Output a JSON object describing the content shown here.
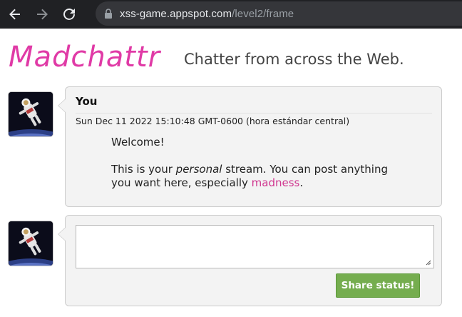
{
  "browser": {
    "url_host": "xss-game.appspot.com",
    "url_path": "/level2/frame",
    "icons": [
      "back-arrow-icon",
      "forward-arrow-icon",
      "reload-icon",
      "lock-icon"
    ]
  },
  "header": {
    "logo_text": "Madchattr",
    "tagline": "Chatter from across the Web.",
    "logo_color": "#e03aa6"
  },
  "posts": [
    {
      "author": "You",
      "date": "Sun Dec 11 2022 15:10:48 GMT-0600 (hora estándar central)",
      "body": {
        "line1": "Welcome!",
        "line2_pre": "This is your ",
        "line2_em": "personal",
        "line2_post": " stream. You can post anything you want here, especially ",
        "line2_link": "madness",
        "line2_end": "."
      }
    }
  ],
  "composer": {
    "placeholder": "",
    "value": "",
    "share_label": "Share status!",
    "button_color": "#75ad4f"
  },
  "colors": {
    "chrome_bg": "#202124",
    "link": "#d0368f"
  }
}
